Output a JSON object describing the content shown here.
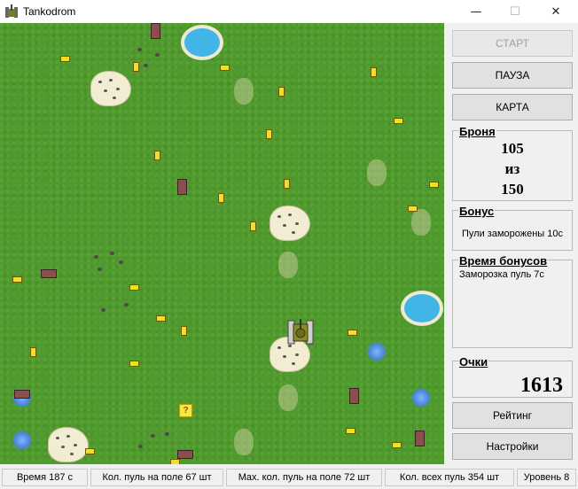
{
  "window": {
    "title": "Tankodrom",
    "minimize_glyph": "—",
    "maximize_glyph": "☐",
    "close_glyph": "✕"
  },
  "sidebar": {
    "start_label": "СТАРТ",
    "pause_label": "ПАУЗА",
    "map_label": "КАРТА",
    "armor": {
      "title": "Броня",
      "current": "105",
      "of": "из",
      "max": "150"
    },
    "bonus": {
      "title": "Бонус",
      "text": "Пули заморожены 10с"
    },
    "bonus_time": {
      "title": "Время бонусов",
      "text": "Заморозка пуль 7с"
    },
    "score": {
      "title": "Очки",
      "value": "1613"
    },
    "rating_label": "Рейтинг",
    "settings_label": "Настройки"
  },
  "status": {
    "time": "Время 187 с",
    "bullets_on_field": "Кол. пуль на поле 67 шт",
    "max_bullets_on_field": "Max. кол. пуль на поле 72 шт",
    "total_bullets": "Кол. всех пуль 354 шт",
    "level": "Уровень 8"
  },
  "field": {
    "bonus_box_label": "?",
    "colors": {
      "grass": "#4e9a2b",
      "bullet": "#f0e020",
      "water": "#41b6e6",
      "enemy": "#8a4f4a"
    }
  }
}
